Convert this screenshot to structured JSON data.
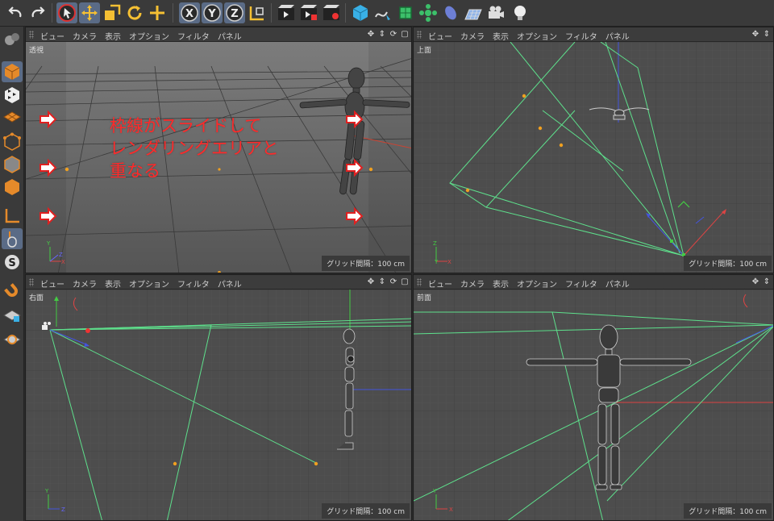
{
  "toolbar": {
    "buttons": [
      {
        "name": "undo-icon"
      },
      {
        "name": "redo-icon"
      },
      {
        "name": "select-arrow-icon",
        "active": true
      },
      {
        "name": "move-icon"
      },
      {
        "name": "scale-icon"
      },
      {
        "name": "rotate-icon"
      },
      {
        "name": "move-crosshair-icon"
      },
      {
        "name": "x-axis-lock",
        "label": "X"
      },
      {
        "name": "y-axis-lock",
        "label": "Y"
      },
      {
        "name": "z-axis-lock",
        "label": "Z"
      },
      {
        "name": "coordinate-system-icon"
      },
      {
        "name": "render-view-icon"
      },
      {
        "name": "render-picture-viewer-icon"
      },
      {
        "name": "render-settings-icon"
      },
      {
        "name": "cube-icon"
      },
      {
        "name": "spline-pen-icon"
      },
      {
        "name": "subdivision-icon"
      },
      {
        "name": "array-icon"
      },
      {
        "name": "deformer-icon"
      },
      {
        "name": "floor-icon"
      },
      {
        "name": "camera-icon"
      },
      {
        "name": "light-icon"
      }
    ]
  },
  "lefttool": {
    "buttons": [
      "layout-icon",
      "model-mode-icon",
      "texture-mode-icon",
      "workplane-mode-icon",
      "points-mode-icon",
      "edges-mode-icon",
      "polygons-mode-icon",
      "axis-mode-icon",
      "tweak-mode-icon",
      "solo-icon",
      "snap-icon",
      "lock-workplane-icon",
      "workplane-snap-icon"
    ]
  },
  "viewports": {
    "menu": [
      "ビュー",
      "カメラ",
      "表示",
      "オプション",
      "フィルタ",
      "パネル"
    ],
    "perspective": {
      "label": "透視",
      "grid": "グリッド間隔：100 cm"
    },
    "top": {
      "label": "上面",
      "grid": "グリッド間隔：100 cm"
    },
    "right": {
      "label": "右面",
      "grid": "グリッド間隔：100 cm"
    },
    "front": {
      "label": "前面",
      "grid": "グリッド間隔：100 cm"
    }
  },
  "annotation": "枠線がスライドして\nレンダリングエリアと\n重なる",
  "colors": {
    "annotation": "#ff2a2a",
    "camera_line": "#5ee08c",
    "accent": "#f0a020"
  }
}
